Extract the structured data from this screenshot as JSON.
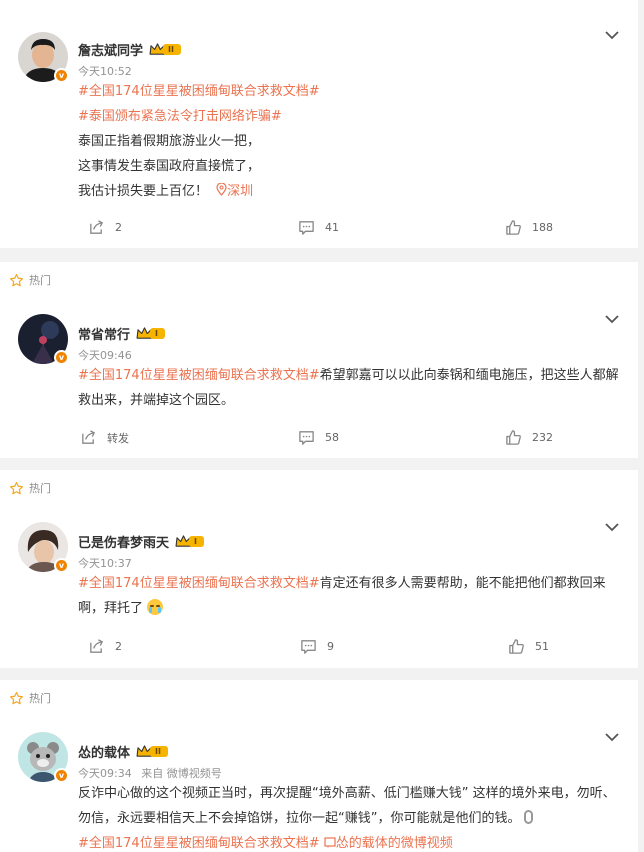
{
  "colors": {
    "accent": "#eb7350",
    "vip": "#f08300",
    "muted": "#939393",
    "crown": "#f6b400"
  },
  "hot_label": "热门",
  "posts": [
    {
      "user": "詹志斌同学",
      "vip_level": "II",
      "time": "今天10:52",
      "lines": [
        {
          "tag": "#全国174位星星被困缅甸联合求救文档#",
          "text": ""
        },
        {
          "tag": "#泰国颁布紧急法令打击网络诈骗#",
          "text": ""
        },
        {
          "tag": "",
          "text": "泰国正指着假期旅游业火一把，"
        },
        {
          "tag": "",
          "text": "这事情发生泰国政府直接慌了，"
        },
        {
          "tag": "",
          "text": "我估计损失要上百亿！"
        }
      ],
      "location": "深圳",
      "share": "2",
      "comments": "41",
      "likes": "188"
    },
    {
      "user": "常省常行",
      "vip_level": "I",
      "time": "今天09:46",
      "tag": "#全国174位星星被困缅甸联合求救文档#",
      "text": "希望郭嘉可以以此向泰锅和缅电施压，把这些人都解救出来，并端掉这个园区。",
      "share": "转发",
      "comments": "58",
      "likes": "232"
    },
    {
      "user": "已是伤春梦雨天",
      "vip_level": "I",
      "time": "今天10:37",
      "tag": "#全国174位星星被困缅甸联合求救文档#",
      "text": "肯定还有很多人需要帮助，能不能把他们都救回来啊，拜托了",
      "share": "2",
      "comments": "9",
      "likes": "51"
    },
    {
      "user": "怂的载体",
      "vip_level": "II",
      "time": "今天09:34",
      "source": "来自 微博视频号",
      "text": "反诈中心做的这个视频正当时，再次提醒“境外高薪、低门槛赚大钱” 这样的境外来电，勿听、勿信，永远要相信天上不会掉馅饼，拉你一起“赚钱”，你可能就是他们的钱。",
      "tag": "#全国174位星星被困缅甸联合求救文档#",
      "link": "怂的载体的微博视频"
    }
  ]
}
